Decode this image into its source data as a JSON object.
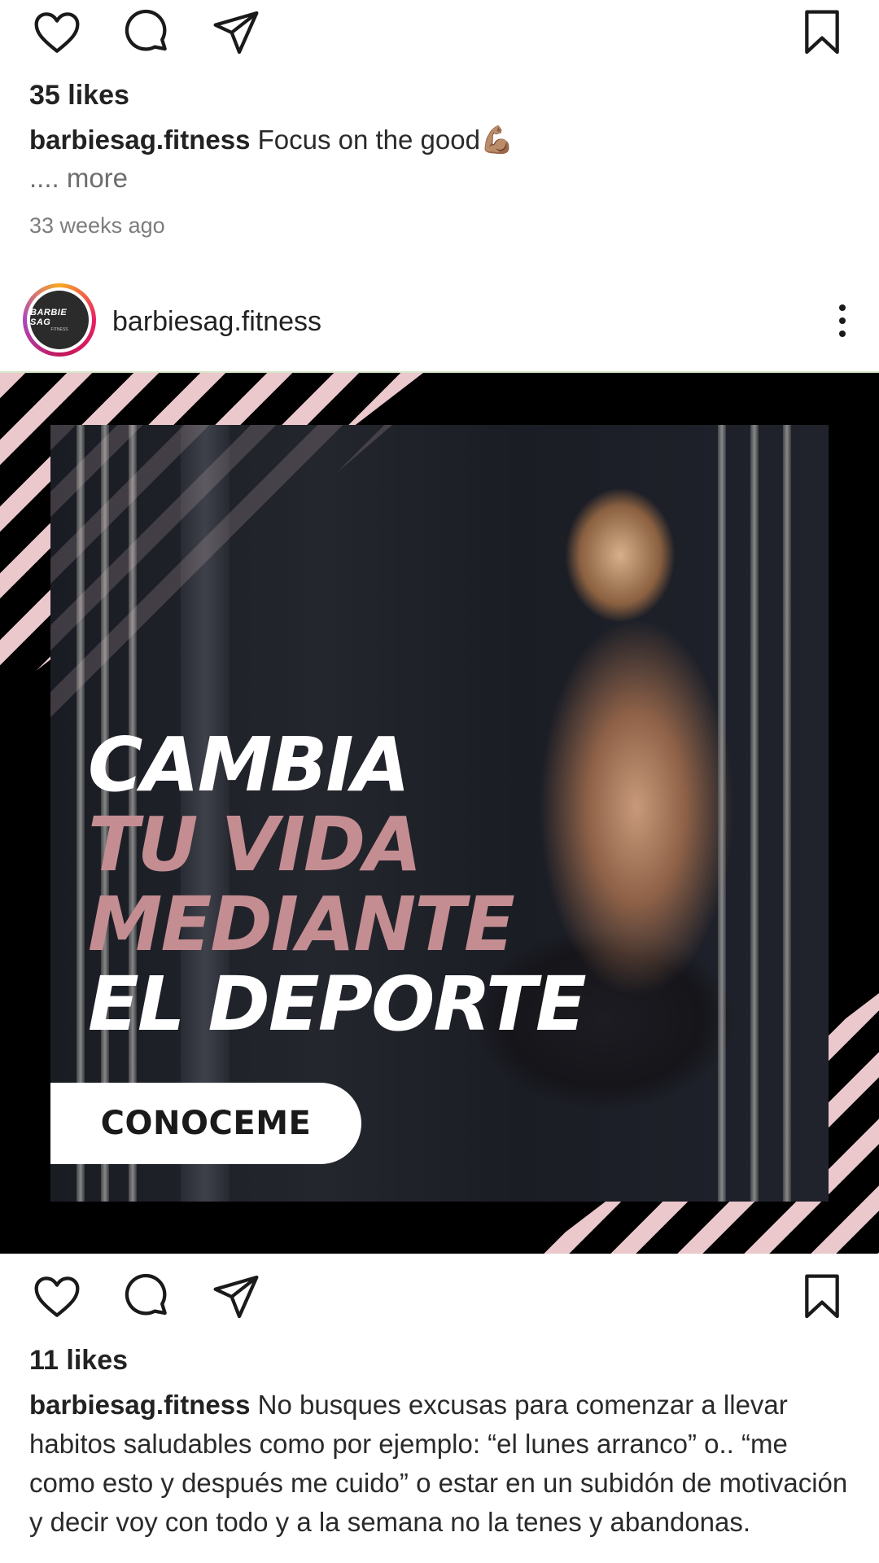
{
  "post1": {
    "likes": "35 likes",
    "username": "barbiesag.fitness",
    "caption": "Focus on the good",
    "emoji": "💪🏽",
    "more": ".... more",
    "time": "33 weeks ago"
  },
  "post2": {
    "header": {
      "username": "barbiesag.fitness",
      "avatar_line1": "BARBIE SAG",
      "avatar_line2": "FITNESS"
    },
    "image": {
      "line1": "CAMBIA",
      "line2": "TU VIDA",
      "line3": "MEDIANTE",
      "line4": "EL DEPORTE",
      "cta": "CONOCEME",
      "colors": {
        "pink": "#c48d92",
        "stripe": "#eac8cc"
      }
    },
    "likes": "11 likes",
    "username": "barbiesag.fitness",
    "caption": "No busques excusas para comenzar a llevar habitos saludables como por ejemplo: “el lunes arranco” o.. “me como esto y después me cuido” o estar en un subidón de motivación y decir voy con todo y a la semana no la tenes y abandonas."
  },
  "icons": [
    "heart-icon",
    "comment-icon",
    "share-icon",
    "bookmark-icon",
    "more-options-icon"
  ]
}
